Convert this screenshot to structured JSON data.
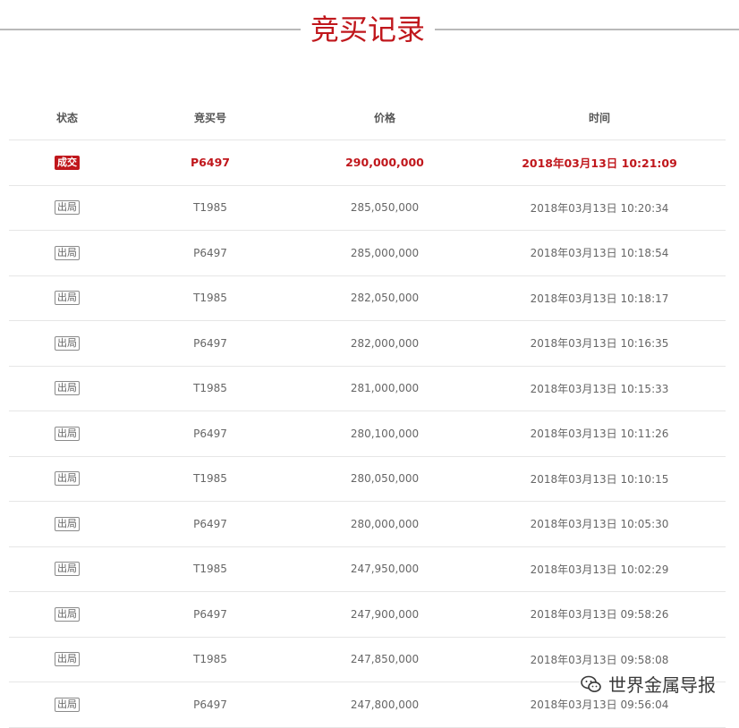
{
  "title": "竞买记录",
  "columns": {
    "status": "状态",
    "code": "竞买号",
    "price": "价格",
    "time": "时间"
  },
  "records": [
    {
      "status": "成交",
      "code": "P6497",
      "price": "290,000,000",
      "time": "2018年03月13日 10:21:09"
    },
    {
      "status": "出局",
      "code": "T1985",
      "price": "285,050,000",
      "time": "2018年03月13日 10:20:34"
    },
    {
      "status": "出局",
      "code": "P6497",
      "price": "285,000,000",
      "time": "2018年03月13日 10:18:54"
    },
    {
      "status": "出局",
      "code": "T1985",
      "price": "282,050,000",
      "time": "2018年03月13日 10:18:17"
    },
    {
      "status": "出局",
      "code": "P6497",
      "price": "282,000,000",
      "time": "2018年03月13日 10:16:35"
    },
    {
      "status": "出局",
      "code": "T1985",
      "price": "281,000,000",
      "time": "2018年03月13日 10:15:33"
    },
    {
      "status": "出局",
      "code": "P6497",
      "price": "280,100,000",
      "time": "2018年03月13日 10:11:26"
    },
    {
      "status": "出局",
      "code": "T1985",
      "price": "280,050,000",
      "time": "2018年03月13日 10:10:15"
    },
    {
      "status": "出局",
      "code": "P6497",
      "price": "280,000,000",
      "time": "2018年03月13日 10:05:30"
    },
    {
      "status": "出局",
      "code": "T1985",
      "price": "247,950,000",
      "time": "2018年03月13日 10:02:29"
    },
    {
      "status": "出局",
      "code": "P6497",
      "price": "247,900,000",
      "time": "2018年03月13日 09:58:26"
    },
    {
      "status": "出局",
      "code": "T1985",
      "price": "247,850,000",
      "time": "2018年03月13日 09:58:08"
    },
    {
      "status": "出局",
      "code": "P6497",
      "price": "247,800,000",
      "time": "2018年03月13日 09:56:04"
    }
  ],
  "watermark": {
    "text": "世界金属导报",
    "icon": "wechat-icon"
  },
  "colors": {
    "accent": "#c0171c",
    "text": "#666666",
    "divider": "#e6e6e6"
  }
}
